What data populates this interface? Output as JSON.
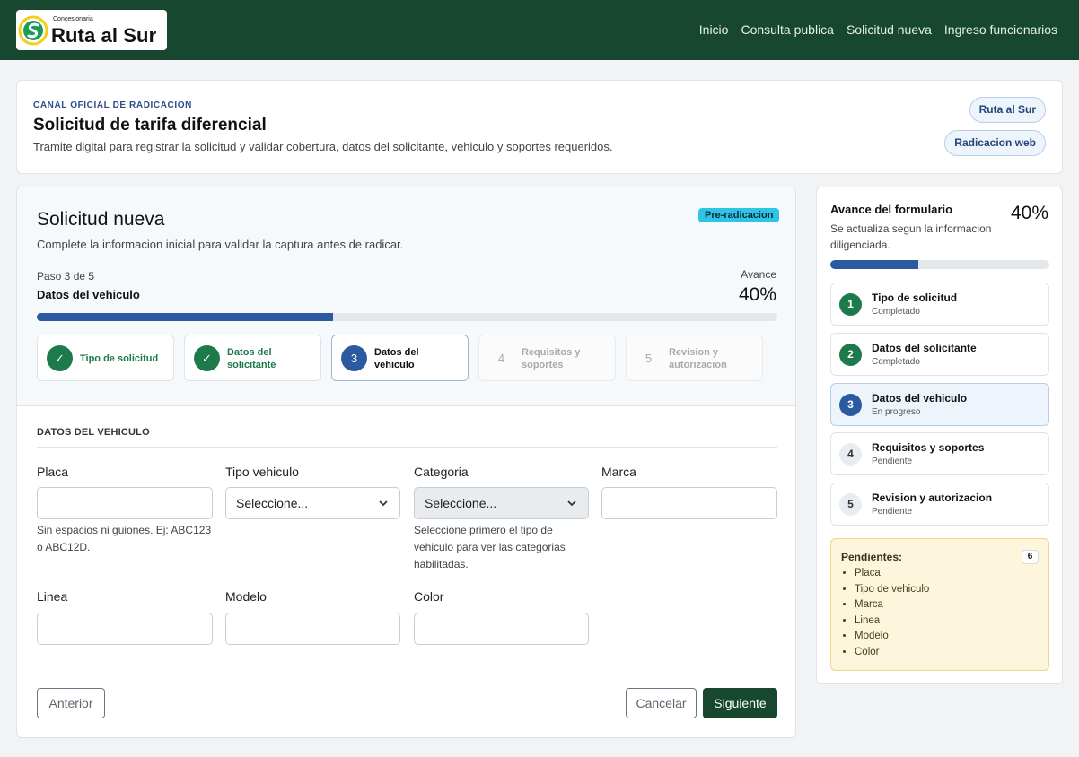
{
  "brand": {
    "small": "Concesionaria",
    "name": "Ruta al Sur"
  },
  "nav": [
    "Inicio",
    "Consulta publica",
    "Solicitud nueva",
    "Ingreso funcionarios"
  ],
  "hero": {
    "eyebrow": "CANAL OFICIAL DE RADICACION",
    "title": "Solicitud de tarifa diferencial",
    "description": "Tramite digital para registrar la solicitud y validar cobertura, datos del solicitante, vehiculo y soportes requeridos.",
    "pills": [
      "Ruta al Sur",
      "Radicacion web"
    ]
  },
  "form": {
    "title": "Solicitud nueva",
    "badge": "Pre-radicacion",
    "subtitle": "Complete la informacion inicial para validar la captura antes de radicar.",
    "step_text": "Paso 3 de 5",
    "step_title": "Datos del vehiculo",
    "avance_label": "Avance",
    "avance_value": "40%",
    "progress_fraction": 0.4,
    "steps": [
      {
        "marker": "✓",
        "label": "Tipo de solicitud",
        "state": "done"
      },
      {
        "marker": "✓",
        "label": "Datos del solicitante",
        "state": "done"
      },
      {
        "marker": "3",
        "label": "Datos del vehiculo",
        "state": "active"
      },
      {
        "marker": "4",
        "label": "Requisitos y soportes",
        "state": "pending"
      },
      {
        "marker": "5",
        "label": "Revision y autorizacion",
        "state": "pending"
      }
    ],
    "section_title": "DATOS DEL VEHICULO",
    "fields": {
      "placa": {
        "label": "Placa",
        "value": "",
        "help": "Sin espacios ni guiones. Ej: ABC123 o ABC12D."
      },
      "tipo": {
        "label": "Tipo vehiculo",
        "value": "Seleccione..."
      },
      "categoria": {
        "label": "Categoria",
        "value": "Seleccione...",
        "help": "Seleccione primero el tipo de vehiculo para ver las categorias habilitadas."
      },
      "marca": {
        "label": "Marca",
        "value": ""
      },
      "linea": {
        "label": "Linea",
        "value": ""
      },
      "modelo": {
        "label": "Modelo",
        "value": ""
      },
      "color": {
        "label": "Color",
        "value": ""
      }
    },
    "buttons": {
      "prev": "Anterior",
      "cancel": "Cancelar",
      "next": "Siguiente"
    }
  },
  "sidebar": {
    "title": "Avance del formulario",
    "percent": "40%",
    "progress_fraction": 0.4,
    "description": "Se actualiza segun la informacion diligenciada.",
    "items": [
      {
        "num": "1",
        "title": "Tipo de solicitud",
        "status": "Completado",
        "state": "done"
      },
      {
        "num": "2",
        "title": "Datos del solicitante",
        "status": "Completado",
        "state": "done"
      },
      {
        "num": "3",
        "title": "Datos del vehiculo",
        "status": "En progreso",
        "state": "active"
      },
      {
        "num": "4",
        "title": "Requisitos y soportes",
        "status": "Pendiente",
        "state": "pending"
      },
      {
        "num": "5",
        "title": "Revision y autorizacion",
        "status": "Pendiente",
        "state": "pending"
      }
    ],
    "pending": {
      "title": "Pendientes:",
      "count": "6",
      "list": [
        "Placa",
        "Tipo de vehiculo",
        "Marca",
        "Linea",
        "Modelo",
        "Color"
      ]
    }
  },
  "colors": {
    "header": "#17472f",
    "accent": "#2c5aa0",
    "success": "#1d7a4a",
    "badge": "#2ec4e6"
  }
}
